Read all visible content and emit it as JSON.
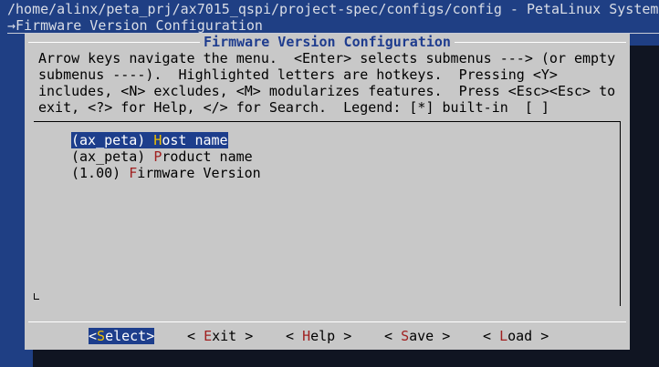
{
  "window": {
    "title": "/home/alinx/peta_prj/ax7015_qspi/project-spec/configs/config - PetaLinux System",
    "breadcrumb": "→Firmware Version Configuration"
  },
  "dialog": {
    "title": "Firmware Version Configuration",
    "help_lines": [
      "Arrow keys navigate the menu.  <Enter> selects submenus ---> (or empty",
      "submenus ----).  Highlighted letters are hotkeys.  Pressing <Y>",
      "includes, <N> excludes, <M> modularizes features.  Press <Esc><Esc> to",
      "exit, <?> for Help, </> for Search.  Legend: [*] built-in  [ ]"
    ]
  },
  "menu": {
    "items": [
      {
        "prefix": "(",
        "value": "ax_peta",
        "mid": ") ",
        "hotkey": "H",
        "rest": "ost name",
        "selected": true
      },
      {
        "prefix": "(",
        "value": "ax_peta",
        "mid": ") ",
        "hotkey": "P",
        "rest": "roduct name",
        "selected": false
      },
      {
        "prefix": "(",
        "value": "1.00",
        "mid": ") ",
        "hotkey": "F",
        "rest": "irmware Version",
        "selected": false
      }
    ]
  },
  "buttons": [
    {
      "open": "<",
      "hotkey": "S",
      "rest": "elect",
      "close": ">",
      "selected": true
    },
    {
      "open": "< ",
      "hotkey": "E",
      "rest": "xit",
      "close": " >",
      "selected": false
    },
    {
      "open": "< ",
      "hotkey": "H",
      "rest": "elp",
      "close": " >",
      "selected": false
    },
    {
      "open": "< ",
      "hotkey": "S",
      "rest": "ave",
      "close": " >",
      "selected": false
    },
    {
      "open": "< ",
      "hotkey": "L",
      "rest": "oad",
      "close": " >",
      "selected": false
    }
  ],
  "colors": {
    "terminal_background": "#1f3f84",
    "dialog_background": "#c8c8c8",
    "selection_background": "#1d3e8c",
    "hotkey": "#a02020",
    "selected_hotkey": "#f0c000"
  }
}
